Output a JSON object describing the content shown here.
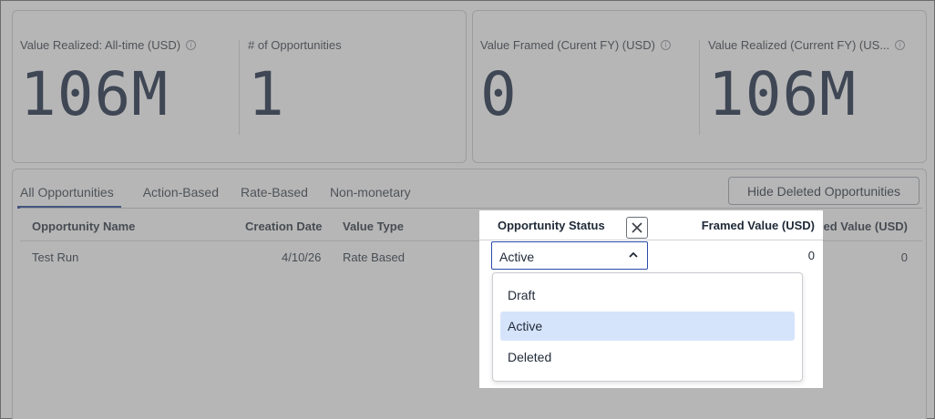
{
  "kpis": [
    {
      "label": "Value Realized: All-time (USD)",
      "value": "106M",
      "info": true
    },
    {
      "label": "# of Opportunities",
      "value": "1",
      "info": false
    },
    {
      "label": "Value Framed (Curent FY) (USD)",
      "value": "0",
      "info": true
    },
    {
      "label": "Value Realized (Current FY) (US...",
      "value": "106M",
      "info": true
    }
  ],
  "tabs": [
    "All Opportunities",
    "Action-Based",
    "Rate-Based",
    "Non-monetary"
  ],
  "active_tab": "All Opportunities",
  "hide_deleted_button": "Hide Deleted Opportunities",
  "table": {
    "headers": [
      "Opportunity Name",
      "Creation Date",
      "Value Type",
      "Opportunity Status",
      "Framed Value (USD)"
    ],
    "rows": [
      {
        "name": "Test Run",
        "date": "4/10/26",
        "type": "Rate Based",
        "status": "Active",
        "framed": "0"
      }
    ]
  },
  "status_editor": {
    "header": "Opportunity Status",
    "selected": "Active",
    "options": [
      "Draft",
      "Active",
      "Deleted"
    ],
    "highlighted": "Active"
  },
  "colors": {
    "kpi_value": "#11203d",
    "tab_active_underline": "#1a3c8f",
    "select_border": "#2a4aa8",
    "option_highlight": "#d6e4fb",
    "overlay": "rgba(110,110,110,0.5)"
  },
  "icons": {
    "info": "info-icon",
    "close": "close-icon",
    "chevron": "chevron-up-icon"
  }
}
